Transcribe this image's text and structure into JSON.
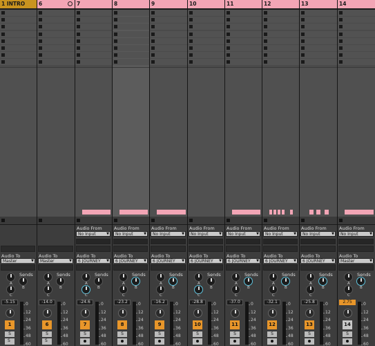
{
  "tracks": [
    {
      "name": "1 INTRO",
      "header": "master",
      "num": "1",
      "vol": "-5.15",
      "vol_orange": false,
      "num_orange": true,
      "has_input": false,
      "audio_to": "Master",
      "clip": false,
      "sel": false,
      "icon": false,
      "send_b_on": false,
      "send_c_on": false,
      "btn2": "S",
      "btn3": "S"
    },
    {
      "name": "6",
      "header": "pink",
      "num": "6",
      "vol": "-14.0",
      "vol_orange": false,
      "num_orange": true,
      "has_input": false,
      "audio_to": "Master",
      "clip": false,
      "sel": false,
      "icon": true,
      "send_b_on": false,
      "send_c_on": false,
      "btn2": "S",
      "btn3": "S"
    },
    {
      "name": "7",
      "header": "pink",
      "num": "7",
      "vol": "-24.6",
      "vol_orange": false,
      "num_orange": true,
      "has_input": true,
      "audio_to": "6 JOURNEY",
      "clip": true,
      "sel": false,
      "icon": false,
      "send_b_on": false,
      "send_c_on": true,
      "btn2": "S",
      "btn3": "rec"
    },
    {
      "name": "8",
      "header": "pink",
      "num": "8",
      "vol": "-23.2",
      "vol_orange": false,
      "num_orange": true,
      "has_input": true,
      "audio_to": "6 JOURNEY",
      "clip": true,
      "sel": true,
      "icon": false,
      "send_b_on": true,
      "send_c_on": false,
      "btn2": "S",
      "btn3": "rec"
    },
    {
      "name": "9",
      "header": "pink",
      "num": "9",
      "vol": "-16.2",
      "vol_orange": false,
      "num_orange": true,
      "has_input": true,
      "audio_to": "6 JOURNEY",
      "clip": true,
      "sel": false,
      "icon": false,
      "send_b_on": true,
      "send_c_on": false,
      "btn2": "S",
      "btn3": "rec"
    },
    {
      "name": "10",
      "header": "pink",
      "num": "10",
      "vol": "-28.8",
      "vol_orange": false,
      "num_orange": true,
      "has_input": true,
      "audio_to": "6 JOURNEY",
      "clip": false,
      "sel": false,
      "icon": false,
      "send_b_on": false,
      "send_c_on": true,
      "btn2": "S",
      "btn3": "rec"
    },
    {
      "name": "11",
      "header": "pink",
      "num": "11",
      "vol": "-37.0",
      "vol_orange": false,
      "num_orange": true,
      "has_input": true,
      "audio_to": "6 JOURNEY",
      "clip": true,
      "sel": false,
      "icon": false,
      "send_b_on": true,
      "send_c_on": false,
      "btn2": "S",
      "btn3": "rec"
    },
    {
      "name": "12",
      "header": "pink",
      "num": "12",
      "vol": "-32.1",
      "vol_orange": false,
      "num_orange": true,
      "has_input": true,
      "audio_to": "6 JOURNEY",
      "clip": true,
      "sel": false,
      "icon": false,
      "send_b_on": true,
      "send_c_on": false,
      "btn2": "S",
      "btn3": "rec"
    },
    {
      "name": "13",
      "header": "pink",
      "num": "13",
      "vol": "-25.8",
      "vol_orange": false,
      "num_orange": true,
      "has_input": true,
      "audio_to": "6 JOURNEY",
      "clip": true,
      "sel": false,
      "icon": false,
      "send_b_on": true,
      "send_c_on": false,
      "btn2": "S",
      "btn3": "rec"
    },
    {
      "name": "14",
      "header": "pink",
      "num": "14",
      "vol": "2.75",
      "vol_orange": true,
      "num_orange": false,
      "has_input": true,
      "audio_to": "Master",
      "clip": true,
      "sel": false,
      "icon": false,
      "send_b_on": true,
      "send_c_on": false,
      "btn2": "S",
      "btn3": "rec"
    }
  ],
  "labels": {
    "audio_from": "Audio From",
    "no_input": "No Input",
    "audio_to": "Audio To",
    "sends": "Sends",
    "send_a": "A",
    "send_b": "B",
    "send_c": "C",
    "solo": "S"
  },
  "meter_scale": [
    "0",
    "12",
    "24",
    "36",
    "48",
    "60"
  ],
  "colors": {
    "header_pink": "#f2a5b5",
    "header_master": "#c8931f",
    "accent_orange": "#e8962a",
    "knob_blue": "#5ec5e0"
  }
}
